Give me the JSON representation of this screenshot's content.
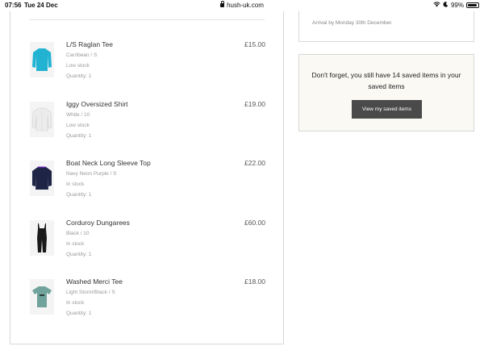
{
  "status_bar": {
    "time": "07:56",
    "date": "Tue 24 Dec",
    "url": "hush-uk.com",
    "battery": "99%"
  },
  "order": {
    "items": [
      {
        "name": "L/S Raglan Tee",
        "price": "£15.00",
        "variant": "Carribean / S",
        "stock": "Low stock",
        "quantity": "Quantity: 1",
        "color": "#22b3d3"
      },
      {
        "name": "Iggy Oversized Shirt",
        "price": "£19.00",
        "variant": "White / 10",
        "stock": "Low stock",
        "quantity": "Quantity: 1",
        "color": "#ececec"
      },
      {
        "name": "Boat Neck Long Sleeve Top",
        "price": "£22.00",
        "variant": "Navy Neon Purple / S",
        "stock": "In stock",
        "quantity": "Quantity: 1",
        "color": "#1e2445"
      },
      {
        "name": "Corduroy Dungarees",
        "price": "£60.00",
        "variant": "Black / 10",
        "stock": "In stock",
        "quantity": "Quantity: 1",
        "color": "#1a1a1a"
      },
      {
        "name": "Washed Merci Tee",
        "price": "£18.00",
        "variant": "Light Storm/Black / S",
        "stock": "In stock",
        "quantity": "Quantity: 1",
        "color": "#6fa39b"
      }
    ]
  },
  "delivery": {
    "arrival": "Arrival by Monday 30th December."
  },
  "saved": {
    "message": "Don't forget, you still have 14 saved items in your saved items",
    "button_label": "View my saved items"
  }
}
